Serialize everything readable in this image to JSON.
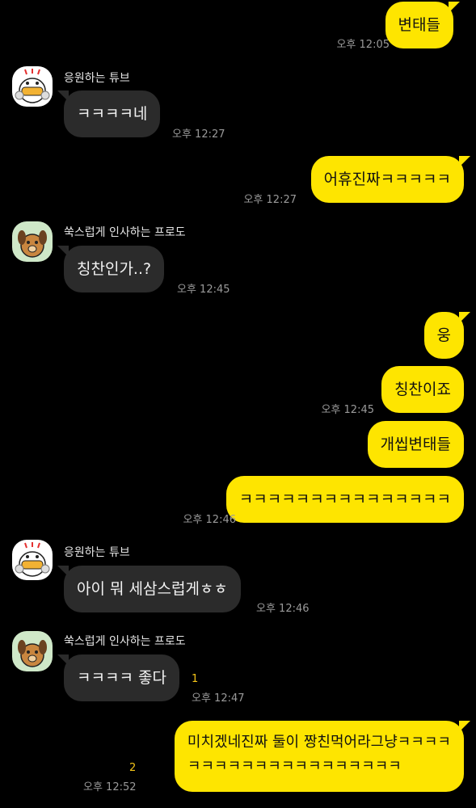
{
  "messages": {
    "m1": {
      "text": "변태들",
      "time": "오후 12:05"
    },
    "m2": {
      "sender": "응원하는 튜브",
      "text": "ㅋㅋㅋㅋ네",
      "time": "오후 12:27"
    },
    "m3": {
      "text": "어휴진짜ㅋㅋㅋㅋㅋ",
      "time": "오후 12:27"
    },
    "m4": {
      "sender": "쑥스럽게 인사하는 프로도",
      "text": "칭찬인가..?",
      "time": "오후 12:45"
    },
    "m5": {
      "text": "웅"
    },
    "m6": {
      "text": "칭찬이죠",
      "time": "오후 12:45"
    },
    "m7": {
      "text": "개씹변태들"
    },
    "m8": {
      "text": "ㅋㅋㅋㅋㅋㅋㅋㅋㅋㅋㅋㅋㅋㅋㅋ",
      "time": "오후 12:46"
    },
    "m9": {
      "sender": "응원하는 튜브",
      "text": "아이 뭐 세삼스럽게ㅎㅎ",
      "time": "오후 12:46"
    },
    "m10": {
      "sender": "쑥스럽게 인사하는 프로도",
      "text": "ㅋㅋㅋㅋ 좋다",
      "unread": "1",
      "time": "오후 12:47"
    },
    "m11": {
      "line1": "미치겠네진짜 둘이 짱친먹어라그냥ㅋㅋㅋㅋ",
      "line2": "ㅋㅋㅋㅋㅋㅋㅋㅋㅋㅋㅋㅋㅋㅋㅋㅋ",
      "unread": "2",
      "time": "오후 12:52"
    }
  },
  "colors": {
    "outgoing": "#fee500",
    "incoming": "#2b2b2b",
    "background": "#000000"
  }
}
